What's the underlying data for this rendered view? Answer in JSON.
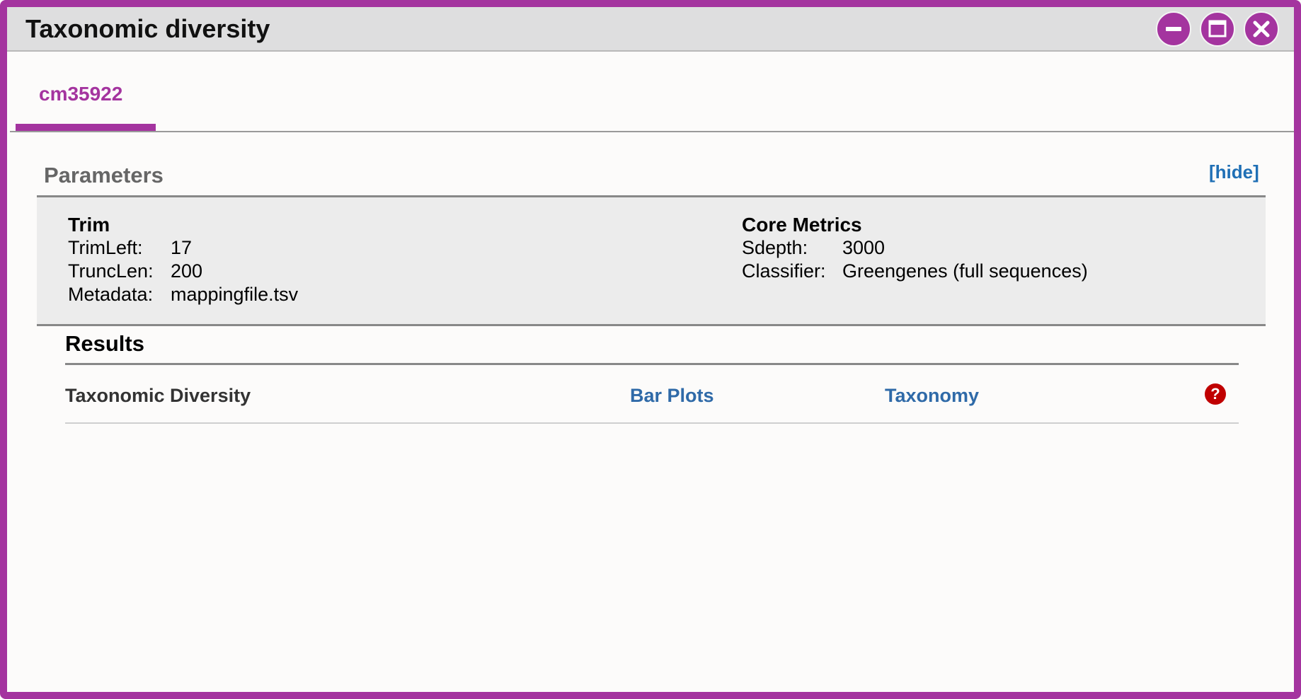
{
  "window": {
    "title": "Taxonomic diversity",
    "accent_color": "#a4349f",
    "controls": [
      "minimize-icon",
      "maximize-icon",
      "close-icon"
    ]
  },
  "tabs": [
    {
      "label": "cm35922",
      "active": true
    }
  ],
  "parameters": {
    "heading": "Parameters",
    "toggle_label": "[hide]",
    "trim": {
      "title": "Trim",
      "rows": [
        {
          "key": "TrimLeft:",
          "value": "17"
        },
        {
          "key": "TruncLen:",
          "value": "200"
        },
        {
          "key": "Metadata:",
          "value": "mappingfile.tsv"
        }
      ]
    },
    "core_metrics": {
      "title": "Core Metrics",
      "rows": [
        {
          "key": "Sdepth:",
          "value": "3000"
        },
        {
          "key": "Classifier:",
          "value": "Greengenes (full sequences)"
        }
      ]
    }
  },
  "results": {
    "heading": "Results",
    "rows": [
      {
        "name": "Taxonomic Diversity",
        "links": [
          "Bar Plots",
          "Taxonomy"
        ],
        "help_icon": "?"
      }
    ]
  },
  "colors": {
    "link": "#2f6aa8",
    "help": "#c00000"
  }
}
